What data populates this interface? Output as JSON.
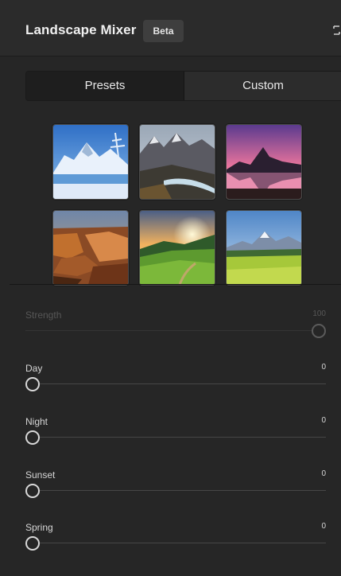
{
  "header": {
    "title": "Landscape Mixer",
    "badge": "Beta"
  },
  "tabs": [
    {
      "label": "Presets",
      "active": true
    },
    {
      "label": "Custom",
      "active": false
    }
  ],
  "presets": [
    {
      "scene": "snowy mountain lake"
    },
    {
      "scene": "mountain valley river"
    },
    {
      "scene": "sunset mountain lake"
    },
    {
      "scene": "canyon cliffs"
    },
    {
      "scene": "green hills sunrise"
    },
    {
      "scene": "alpine meadow"
    }
  ],
  "sliders": [
    {
      "label": "Strength",
      "value": "100",
      "level": 1.0,
      "disabled": true
    },
    {
      "label": "Day",
      "value": "0",
      "level": 0.0,
      "disabled": false
    },
    {
      "label": "Night",
      "value": "0",
      "level": 0.0,
      "disabled": false
    },
    {
      "label": "Sunset",
      "value": "0",
      "level": 0.0,
      "disabled": false
    },
    {
      "label": "Spring",
      "value": "0",
      "level": 0.0,
      "disabled": false
    }
  ],
  "colors": {
    "panel": "#262626",
    "header": "#2b2b2b",
    "text": "#f0f0f0",
    "knob": "#d8d8d8"
  },
  "icons": {
    "collapse": "collapse-panel-icon"
  }
}
